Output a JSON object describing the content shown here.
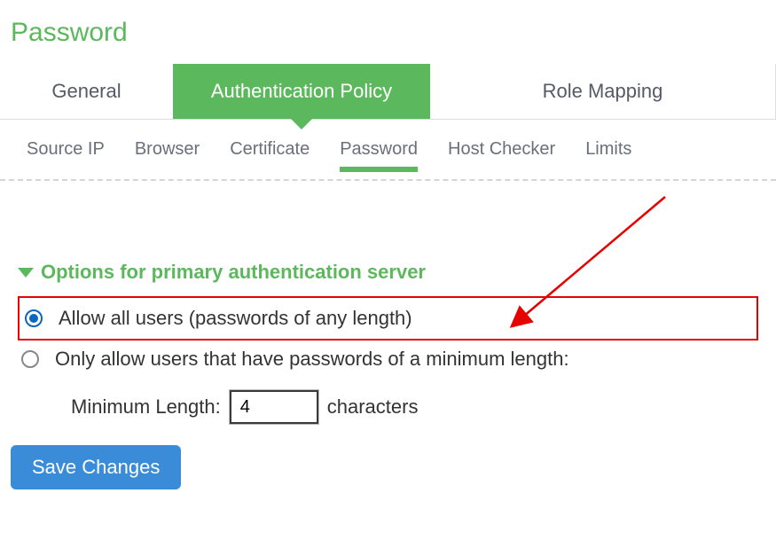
{
  "page_title": "Password",
  "primary_tabs": {
    "general": "General",
    "auth_policy": "Authentication Policy",
    "role_mapping": "Role Mapping"
  },
  "sub_tabs": {
    "source_ip": "Source IP",
    "browser": "Browser",
    "certificate": "Certificate",
    "password": "Password",
    "host_checker": "Host Checker",
    "limits": "Limits"
  },
  "section_header": "Options for primary authentication server",
  "options": {
    "allow_all": "Allow all users (passwords of any length)",
    "min_length_only": "Only allow users that have passwords of a minimum length:"
  },
  "min_length": {
    "label": "Minimum Length:",
    "value": "4",
    "suffix": "characters"
  },
  "save_button": "Save Changes"
}
